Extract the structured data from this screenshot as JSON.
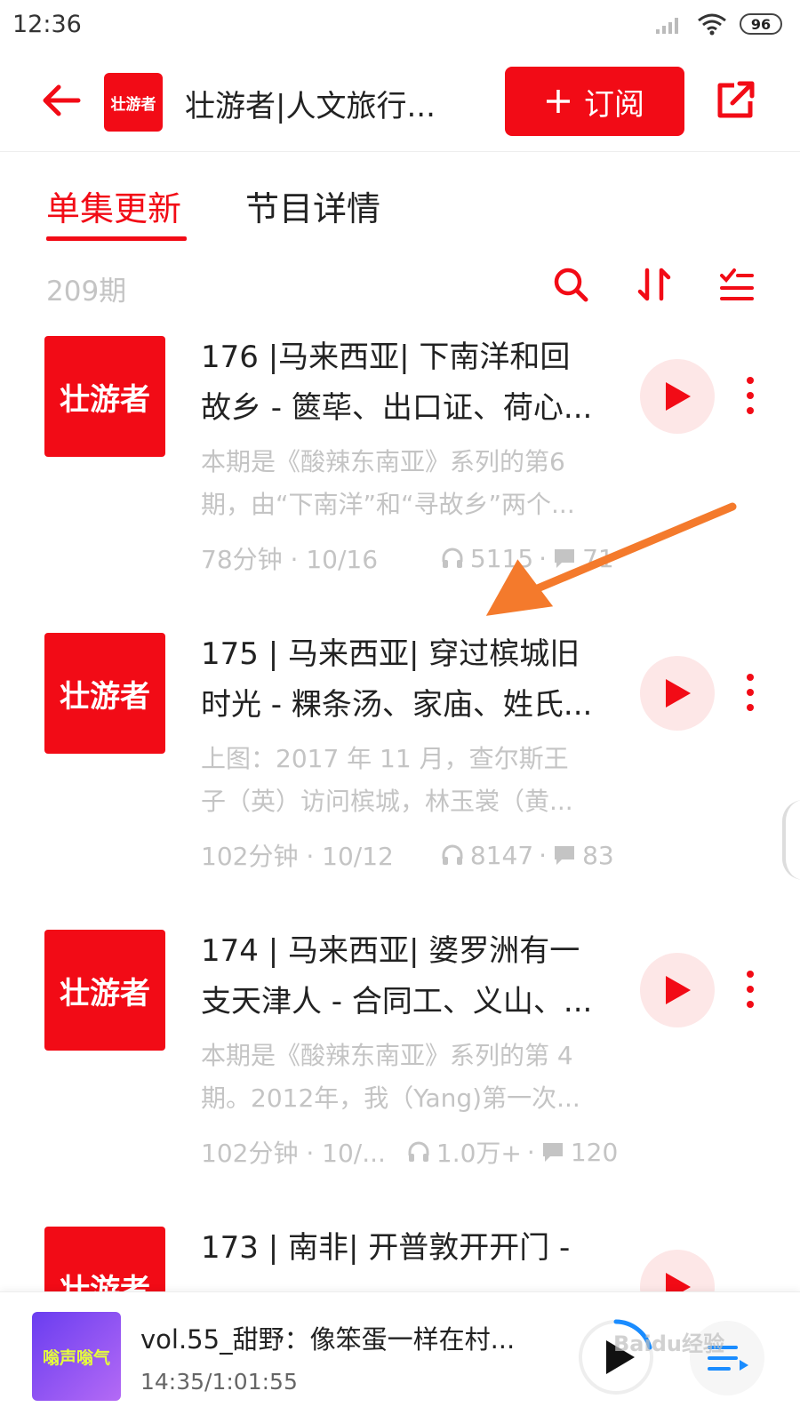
{
  "status_bar": {
    "time": "12:36",
    "battery": "96"
  },
  "header": {
    "title": "壮游者|人文旅行...",
    "logo_text": "壮游者",
    "subscribe_label": "订阅"
  },
  "tabs": [
    {
      "label": "单集更新"
    },
    {
      "label": "节目详情"
    }
  ],
  "episode_count": "209期",
  "episodes": [
    {
      "logo_text": "壮游者",
      "title_line1": "176 |马来西亚| 下南洋和回",
      "title_line2": "故乡 - 篋荜、出口证、荷心...",
      "desc_line1": "本期是《酸辣东南亚》系列的第6",
      "desc_line2": "期，由“下南洋”和“寻故乡”两个...",
      "duration_date": "78分钟 · 10/16",
      "plays": "5115",
      "comments": "71"
    },
    {
      "logo_text": "壮游者",
      "title_line1": "175 | 马来西亚| 穿过槟城旧",
      "title_line2": "时光 - 粿条汤、家庙、姓氏...",
      "desc_line1": "上图：2017 年 11 月，查尔斯王",
      "desc_line2": "子（英）访问槟城，林玉裳（黄...",
      "duration_date": "102分钟 · 10/12",
      "plays": "8147",
      "comments": "83"
    },
    {
      "logo_text": "壮游者",
      "title_line1": "174 | 马来西亚| 婆罗洲有一",
      "title_line2": "支天津人 - 合同工、义山、...",
      "desc_line1": "本期是《酸辣东南亚》系列的第 4",
      "desc_line2": "期。2012年，我（Yang)第一次...",
      "duration_date": "102分钟 · 10/...",
      "plays": "1.0万+",
      "comments": "120"
    },
    {
      "logo_text": "壮游者",
      "title_line1": "173 | 南非| 开普敦开开门 -",
      "title_line2": "",
      "desc_line1": "",
      "desc_line2": "",
      "duration_date": "",
      "plays": "",
      "comments": ""
    }
  ],
  "player": {
    "title": "vol.55_甜野：像笨蛋一样在村...",
    "time": "14:35/1:01:55",
    "cover_text": "嗡声嗡气"
  },
  "watermark": "Baidu经验",
  "colors": {
    "accent": "#f20b16",
    "play_bg": "#fde7e7",
    "arrow": "#f47a2c"
  }
}
